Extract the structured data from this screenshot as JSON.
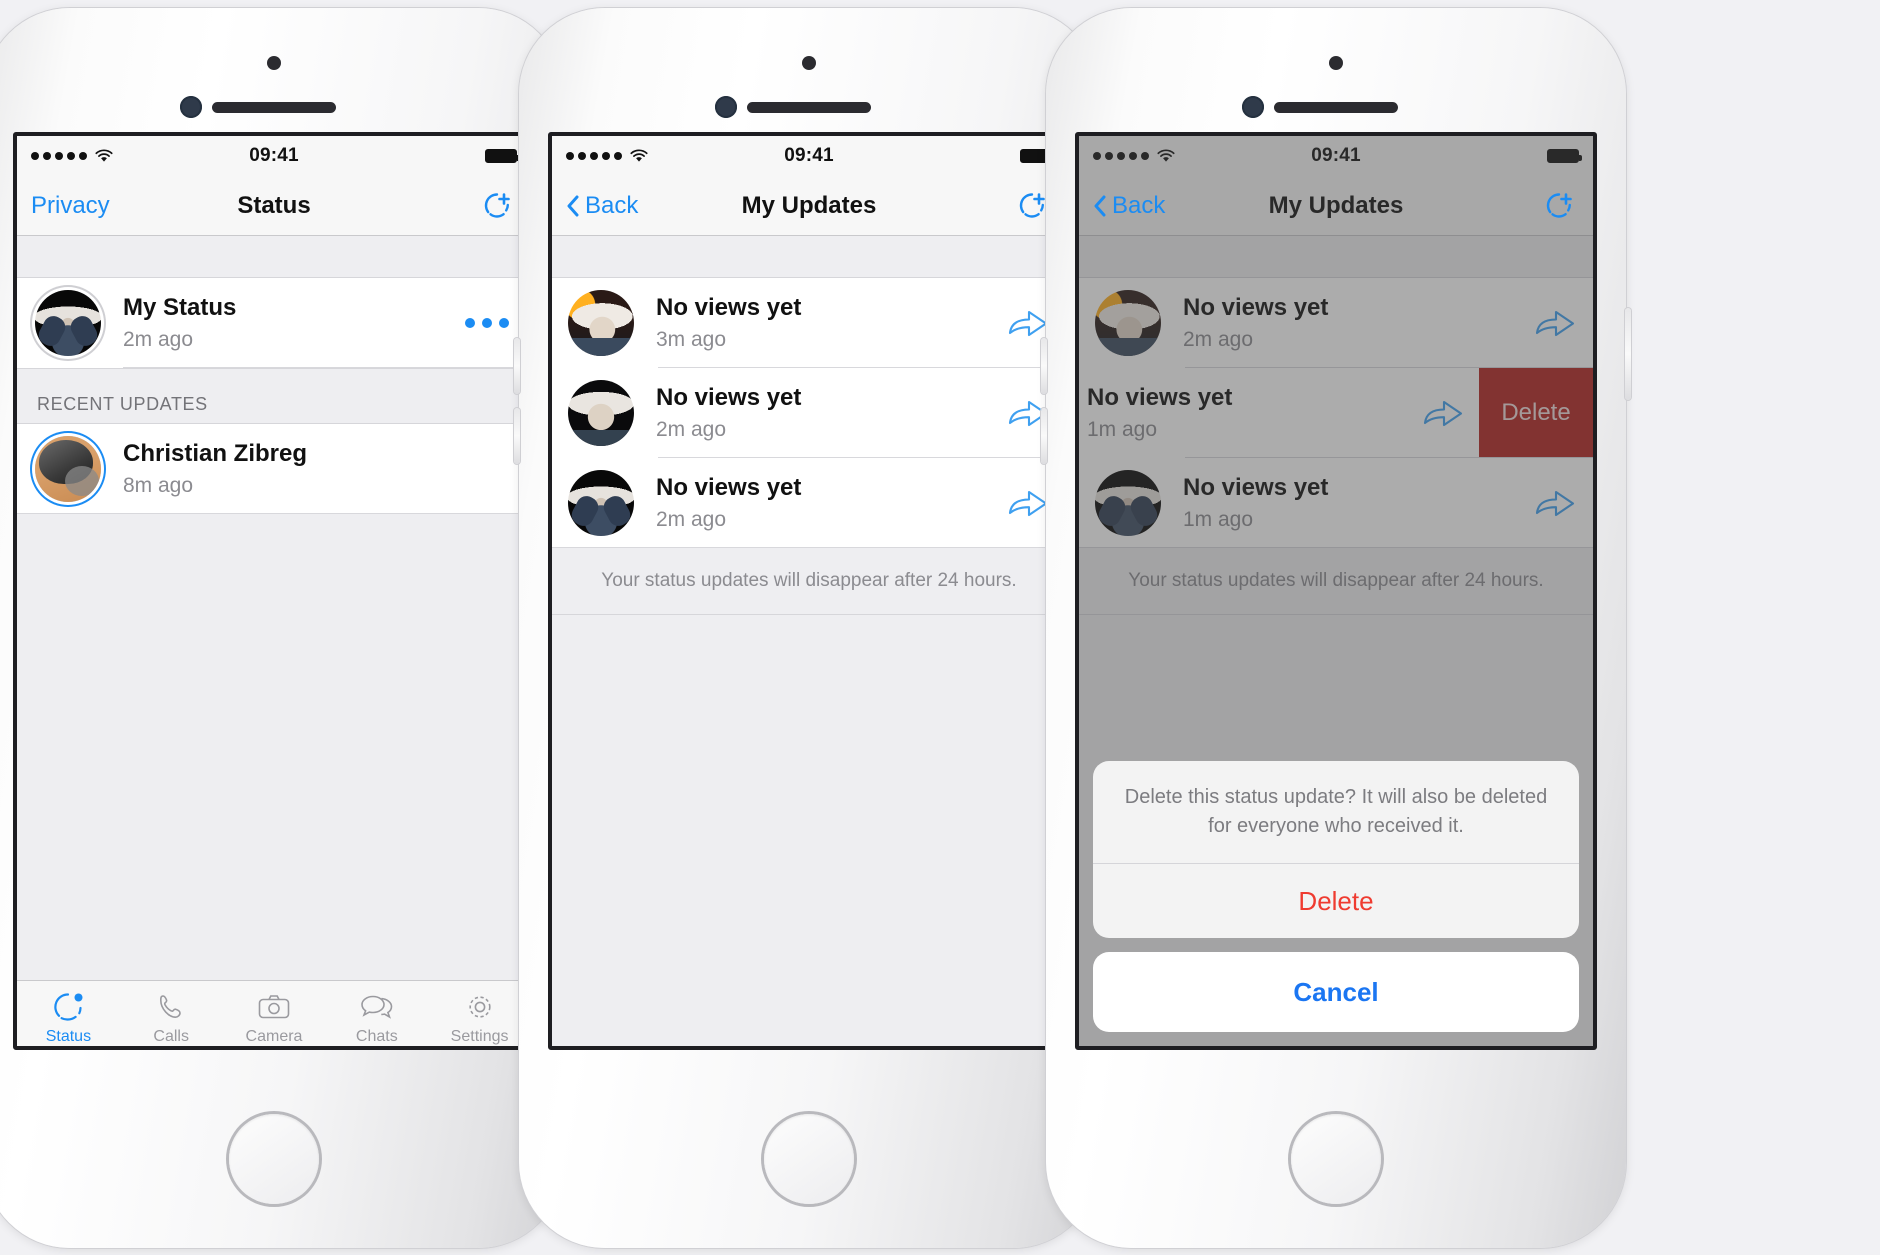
{
  "phones": [
    {
      "id": "status-list",
      "statusbar": {
        "signal_dots": 5,
        "wifi_icon": "wifi-icon",
        "time": "09:41",
        "battery_icon": "battery-full-icon"
      },
      "nav": {
        "left_label": "Privacy",
        "title": "Status",
        "right_icon": "add-status-icon",
        "has_back_chevron": false
      },
      "my_status": {
        "name": "My Status",
        "time": "2m ago",
        "avatar": "tim-arms-avatar",
        "more_icon": "more-dots-icon"
      },
      "section_header": "RECENT UPDATES",
      "recent_updates": [
        {
          "name": "Christian Zibreg",
          "time": "8m ago",
          "avatar": "cat-avatar"
        }
      ],
      "tabs": [
        {
          "label": "Status",
          "icon": "status-icon",
          "active": true
        },
        {
          "label": "Calls",
          "icon": "phone-icon",
          "active": false
        },
        {
          "label": "Camera",
          "icon": "camera-icon",
          "active": false
        },
        {
          "label": "Chats",
          "icon": "chats-icon",
          "active": false
        },
        {
          "label": "Settings",
          "icon": "gear-icon",
          "active": false
        }
      ]
    },
    {
      "id": "my-updates",
      "statusbar": {
        "signal_dots": 5,
        "wifi_icon": "wifi-icon",
        "time": "09:41",
        "battery_icon": "battery-full-icon"
      },
      "nav": {
        "left_label": "Back",
        "title": "My Updates",
        "right_icon": "add-status-icon",
        "has_back_chevron": true
      },
      "updates": [
        {
          "title": "No views yet",
          "time": "3m ago",
          "avatar": "tim-sun-avatar",
          "forward_icon": "forward-arrow-icon"
        },
        {
          "title": "No views yet",
          "time": "2m ago",
          "avatar": "tim-dark-avatar",
          "forward_icon": "forward-arrow-icon"
        },
        {
          "title": "No views yet",
          "time": "2m ago",
          "avatar": "tim-arms-avatar",
          "forward_icon": "forward-arrow-icon"
        }
      ],
      "footnote": "Your status updates will disappear after 24 hours."
    },
    {
      "id": "my-updates-delete",
      "statusbar": {
        "signal_dots": 5,
        "wifi_icon": "wifi-icon",
        "time": "09:41",
        "battery_icon": "battery-full-icon"
      },
      "nav": {
        "left_label": "Back",
        "title": "My Updates",
        "right_icon": "add-status-icon",
        "has_back_chevron": true
      },
      "updates": [
        {
          "title": "No views yet",
          "time": "2m ago",
          "avatar": "tim-sun-avatar",
          "forward_icon": "forward-arrow-icon",
          "swiped": false
        },
        {
          "title": "No views yet",
          "time": "1m ago",
          "avatar": "tim-dark-avatar",
          "forward_icon": "forward-arrow-icon",
          "swiped": true,
          "swipe_action": "Delete"
        },
        {
          "title": "No views yet",
          "time": "1m ago",
          "avatar": "tim-arms-avatar",
          "forward_icon": "forward-arrow-icon",
          "swiped": false
        }
      ],
      "footnote": "Your status updates will disappear after 24 hours.",
      "action_sheet": {
        "message": "Delete this status update? It will also be deleted for everyone who received it.",
        "destructive_label": "Delete",
        "cancel_label": "Cancel"
      }
    }
  ],
  "colors": {
    "accent_blue": "#1b8cf3",
    "cancel_blue": "#1b76f2",
    "destructive_red": "#ef3b30",
    "swipe_delete_red": "#b2231f",
    "list_bg": "#eeeef1",
    "bar_bg": "#f7f7f7",
    "secondary_text": "#8b8b90"
  }
}
